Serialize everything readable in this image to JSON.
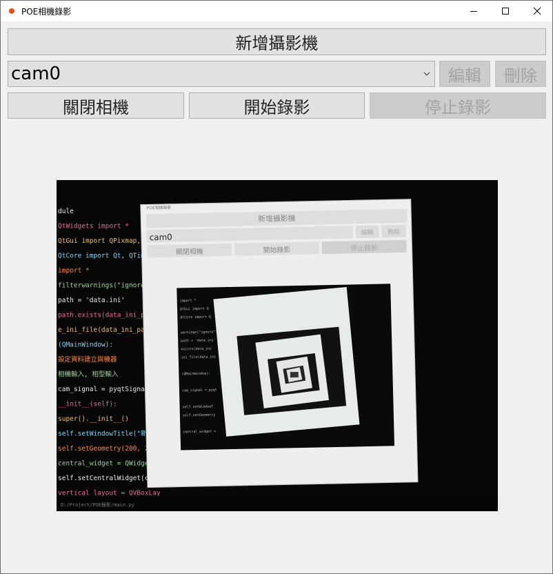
{
  "window": {
    "title": "POE相機錄影",
    "controls": {
      "minimize_icon": "minimize-icon",
      "maximize_icon": "maximize-icon",
      "close_icon": "close-icon"
    }
  },
  "toolbar": {
    "add_camera_label": "新增攝影機",
    "camera_select_value": "cam0",
    "edit_label": "編輯",
    "delete_label": "刪除",
    "close_camera_label": "關閉相機",
    "start_record_label": "開始錄影",
    "stop_record_label": "停止錄影"
  },
  "preview": {
    "inner_title": "POE相機錄影",
    "inner_add_label": "新增攝影機",
    "inner_edit_label": "編輯",
    "inner_delete_label": "刪除",
    "inner_camera_value": "cam0",
    "inner_close_label": "關閉相機",
    "inner_start_label": "開始錄影",
    "inner_stop_label": "停止錄影",
    "code_lines": [
      "dule",
      "QtWidgets import *",
      "QtGui import QPixmap, Q",
      "QtCore import Qt, QTime",
      "import *",
      "filterwarnings(\"ignore\")",
      "path = 'data.ini'",
      "path.exists(data_ini_pat",
      "e_ini_file(data_ini_path)",
      "(QMainWindow):",
      "設定資料建立與機器",
      "相機輸入, 相型輸入",
      "cam_signal = pyqtSignal(st",
      "__init__(self):",
      "super().__init__()",
      "self.setWindowTitle(\"新增攝",
      "self.setGeometry(200, 200,",
      "central_widget = QWidget()",
      "self.setCentralWidget(cent",
      "vertical_layout = QVBoxLay"
    ],
    "status_line": "D:/Project/POE錄影/main.py"
  },
  "colors": {
    "accent_red": "#ea4f1c",
    "button_bg": "#e1e1e1",
    "window_bg": "#f0f0f0"
  }
}
